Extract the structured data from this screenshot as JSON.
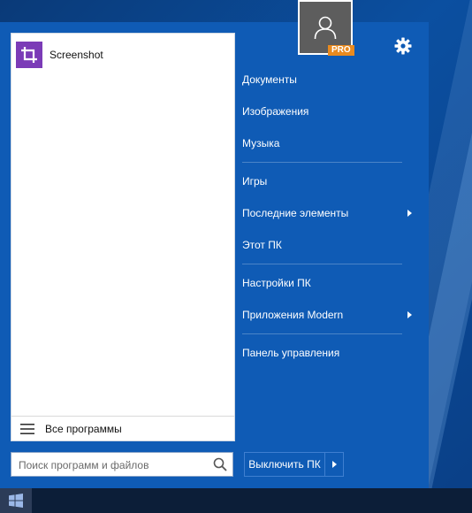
{
  "pinned": [
    {
      "label": "Screenshot",
      "icon": "crop-icon"
    }
  ],
  "all_programs": {
    "label": "Все программы",
    "icon": "hamburger-icon"
  },
  "search": {
    "placeholder": "Поиск программ и файлов"
  },
  "user": {
    "badge": "PRO"
  },
  "right_menu": [
    {
      "label": "Документы"
    },
    {
      "label": "Изображения"
    },
    {
      "label": "Музыка"
    },
    {
      "label": "Игры"
    },
    {
      "label": "Последние элементы"
    },
    {
      "label": "Этот ПК"
    },
    {
      "label": "Настройки ПК"
    },
    {
      "label": "Приложения Modern"
    },
    {
      "label": "Панель управления"
    }
  ],
  "power": {
    "label": "Выключить ПК"
  },
  "colors": {
    "menu_bg": "#0f5bb5",
    "app_icon": "#7b3bb7",
    "pro_badge": "#e98a1f"
  }
}
